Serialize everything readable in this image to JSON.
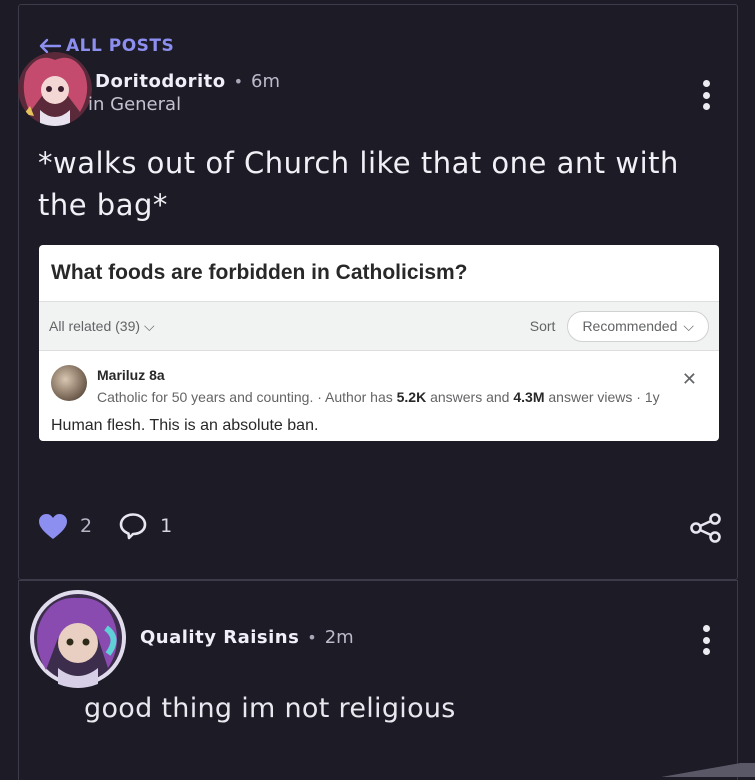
{
  "nav": {
    "back_label": "ALL POSTS"
  },
  "post": {
    "author": "Doritodorito",
    "time": "6m",
    "community": "in General",
    "text": "*walks out of Church like that one ant with the bag*",
    "likes": "2",
    "comments": "1"
  },
  "embed": {
    "question": "What foods are forbidden in Catholicism?",
    "related": "All related (39)",
    "sort_label": "Sort",
    "sort_value": "Recommended",
    "answerer": "Mariluz 8a",
    "cred_prefix": "Catholic for 50 years and counting. · Author has ",
    "cred_answers": "5.2K",
    "cred_mid": " answers and ",
    "cred_views": "4.3M",
    "cred_suffix": " answer views · 1y",
    "answer": "Human flesh. This is an absolute ban."
  },
  "reply": {
    "author": "Quality Raisins",
    "time": "2m",
    "text": "good thing im not religious"
  },
  "colors": {
    "accent": "#8c8ff0",
    "background": "#1d1b26",
    "like": "#8c8ff0"
  }
}
